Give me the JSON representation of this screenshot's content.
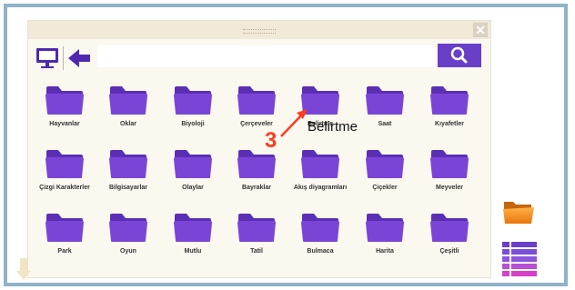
{
  "search": {
    "placeholder": "",
    "value": ""
  },
  "folders": [
    [
      "Hayvanlar",
      "Oklar",
      "Biyoloji",
      "Çerçeveler",
      "Belirtme",
      "Saat",
      "Kıyafetler"
    ],
    [
      "Çizgi Karakterler",
      "Bilgisayarlar",
      "Olaylar",
      "Bayraklar",
      "Akış diyagramları",
      "Çiçekler",
      "Meyveler"
    ],
    [
      "Park",
      "Oyun",
      "Mutlu",
      "Tatil",
      "Bulmaca",
      "Harita",
      "Çeşitli"
    ]
  ],
  "annotation": {
    "number": "3",
    "label": "Belirtme"
  },
  "colors": {
    "accent": "#6a3fc8",
    "folder": "#7a45d6",
    "folder_dark": "#5b2fb4",
    "annotation": "#ff3b1f",
    "frame": "#8fb3c8"
  },
  "icons": {
    "close": "close-icon",
    "monitor": "monitor-icon",
    "back": "arrow-left-icon",
    "search": "search-icon",
    "side_folder": "folder-open-icon",
    "side_menu": "list-menu-icon"
  }
}
